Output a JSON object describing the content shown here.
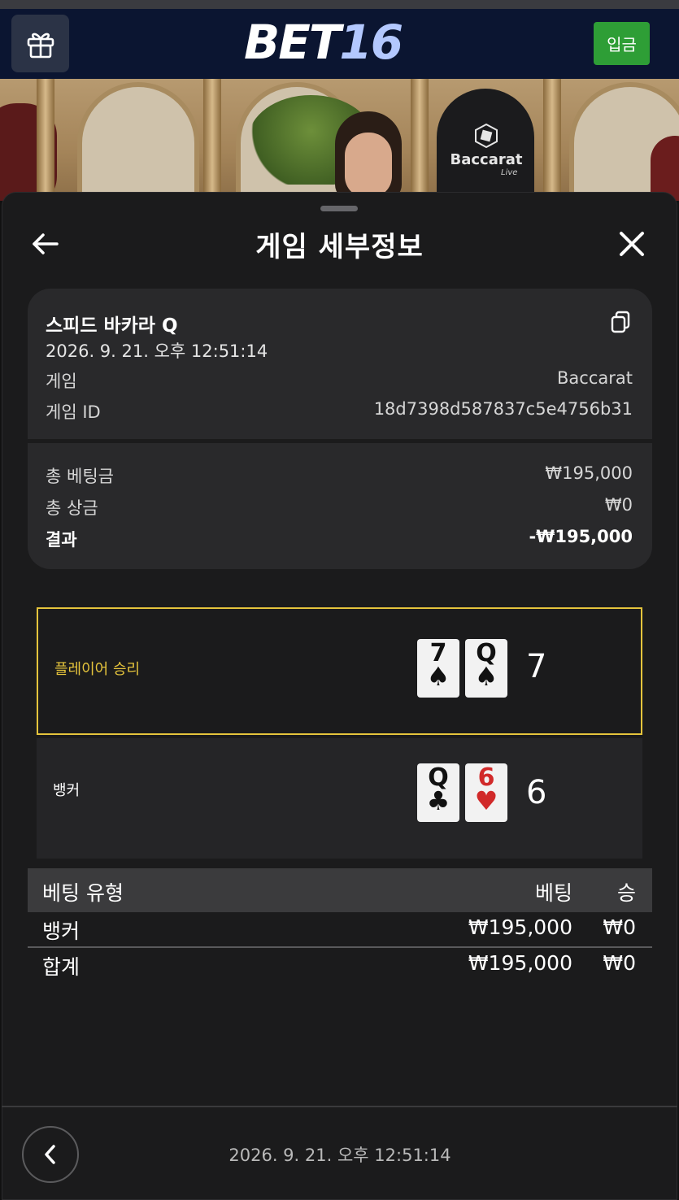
{
  "header": {
    "logo_part1": "BET",
    "logo_part2": "16",
    "deposit_label": "입금",
    "brand_colors": {
      "header_bg": "#0b1531",
      "logo_accent": "#b3c8ff",
      "deposit_bg": "#2e9e36"
    }
  },
  "live_preview": {
    "table_logo": "Baccarat",
    "table_logo_sub": "Live"
  },
  "sheet": {
    "title": "게임 세부정보"
  },
  "details": {
    "game_name": "스피드 바카라 Q",
    "timestamp": "2026. 9. 21. 오후 12:51:14",
    "game_label": "게임",
    "game_value": "Baccarat",
    "game_id_label": "게임 ID",
    "game_id_value": "18d7398d587837c5e4756b31",
    "total_bet_label": "총 베팅금",
    "total_bet_value": "₩195,000",
    "total_win_label": "총 상금",
    "total_win_value": "₩0",
    "result_label": "결과",
    "result_value": "-₩195,000"
  },
  "hands": {
    "player": {
      "label": "플레이어 승리",
      "cards": [
        {
          "rank": "7",
          "suit": "♠"
        },
        {
          "rank": "Q",
          "suit": "♠"
        }
      ],
      "score": "7",
      "highlight_color": "#e5c43c"
    },
    "banker": {
      "label": "뱅커",
      "cards": [
        {
          "rank": "Q",
          "suit": "♣"
        },
        {
          "rank": "6",
          "suit": "♥"
        }
      ],
      "score": "6"
    }
  },
  "bet_table": {
    "columns": [
      "베팅 유형",
      "베팅",
      "승"
    ],
    "rows": [
      [
        "뱅커",
        "₩195,000",
        "₩0"
      ],
      [
        "합계",
        "₩195,000",
        "₩0"
      ]
    ]
  },
  "footer": {
    "timestamp": "2026. 9. 21. 오후 12:51:14"
  }
}
